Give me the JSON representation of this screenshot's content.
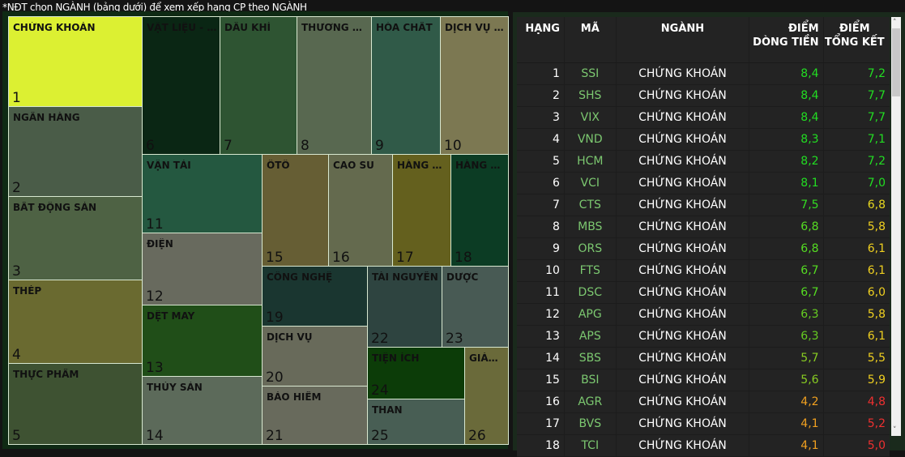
{
  "note": "*NĐT chọn NGÀNH (bảng dưới) để xem xếp hạng CP theo NGÀNH",
  "treemap": [
    {
      "label": "CHỨNG KHOÁN",
      "rank": "1",
      "color": "#dcf032"
    },
    {
      "label": "NGÂN HÀNG",
      "rank": "2",
      "color": "#4a5c48"
    },
    {
      "label": "BẤT ĐỘNG SẢN",
      "rank": "3",
      "color": "#4e6244"
    },
    {
      "label": "THÉP",
      "rank": "4",
      "color": "#6a6a30"
    },
    {
      "label": "THỰC PHẨM",
      "rank": "5",
      "color": "#3e5232"
    },
    {
      "label": "VẬT LIỆU - X...",
      "rank": "6",
      "color": "#0a2614"
    },
    {
      "label": "DẦU KHÍ",
      "rank": "7",
      "color": "#2e5432"
    },
    {
      "label": "THƯƠNG MẠI",
      "rank": "8",
      "color": "#586850"
    },
    {
      "label": "HÓA CHẤT",
      "rank": "9",
      "color": "#305a48"
    },
    {
      "label": "DỊCH VỤ T...",
      "rank": "10",
      "color": "#7c7852"
    },
    {
      "label": "VẬN TẢI",
      "rank": "11",
      "color": "#245840"
    },
    {
      "label": "ĐIỆN",
      "rank": "12",
      "color": "#686a5e"
    },
    {
      "label": "DỆT MAY",
      "rank": "13",
      "color": "#204e18"
    },
    {
      "label": "THỦY SẢN",
      "rank": "14",
      "color": "#5c6a5a"
    },
    {
      "label": "ÔTÔ",
      "rank": "15",
      "color": "#665e34"
    },
    {
      "label": "CAO SU",
      "rank": "16",
      "color": "#646a4e"
    },
    {
      "label": "HÀNG K...",
      "rank": "17",
      "color": "#64601e"
    },
    {
      "label": "HÀNG D...",
      "rank": "18",
      "color": "#0c3c24"
    },
    {
      "label": "CÔNG NGHỆ",
      "rank": "19",
      "color": "#1a3630"
    },
    {
      "label": "DỊCH VỤ",
      "rank": "20",
      "color": "#686a5a"
    },
    {
      "label": "BẢO HIỂM",
      "rank": "21",
      "color": "#686a5c"
    },
    {
      "label": "TÀI NGUYÊN",
      "rank": "22",
      "color": "#2e4440"
    },
    {
      "label": "DƯỢC",
      "rank": "23",
      "color": "#485a54"
    },
    {
      "label": "TIỆN ÍCH",
      "rank": "24",
      "color": "#0c3c08"
    },
    {
      "label": "THAN",
      "rank": "25",
      "color": "#485e54"
    },
    {
      "label": "GIÁO...",
      "rank": "26",
      "color": "#6a6a3a"
    }
  ],
  "table": {
    "headers": {
      "rank": "HẠNG",
      "code": "MÃ",
      "sector": "NGÀNH",
      "flow": "ĐIỂM DÒNG TIỀN",
      "total": "ĐIỂM TỔNG KẾT"
    },
    "rows": [
      {
        "rank": "1",
        "code": "SSI",
        "sector": "CHỨNG KHOÁN",
        "flow": "8,4",
        "total": "7,2",
        "flow_color": "#22dd22",
        "total_color": "#22dd22"
      },
      {
        "rank": "2",
        "code": "SHS",
        "sector": "CHỨNG KHOÁN",
        "flow": "8,4",
        "total": "7,7",
        "flow_color": "#22dd22",
        "total_color": "#22dd22"
      },
      {
        "rank": "3",
        "code": "VIX",
        "sector": "CHỨNG KHOÁN",
        "flow": "8,4",
        "total": "7,7",
        "flow_color": "#22dd22",
        "total_color": "#22dd22"
      },
      {
        "rank": "4",
        "code": "VND",
        "sector": "CHỨNG KHOÁN",
        "flow": "8,3",
        "total": "7,1",
        "flow_color": "#22dd22",
        "total_color": "#22dd22"
      },
      {
        "rank": "5",
        "code": "HCM",
        "sector": "CHỨNG KHOÁN",
        "flow": "8,2",
        "total": "7,2",
        "flow_color": "#22dd22",
        "total_color": "#22dd22"
      },
      {
        "rank": "6",
        "code": "VCI",
        "sector": "CHỨNG KHOÁN",
        "flow": "8,1",
        "total": "7,0",
        "flow_color": "#22dd22",
        "total_color": "#22dd22"
      },
      {
        "rank": "7",
        "code": "CTS",
        "sector": "CHỨNG KHOÁN",
        "flow": "7,5",
        "total": "6,8",
        "flow_color": "#33dd22",
        "total_color": "#e8d820"
      },
      {
        "rank": "8",
        "code": "MBS",
        "sector": "CHỨNG KHOÁN",
        "flow": "6,8",
        "total": "5,8",
        "flow_color": "#55dd22",
        "total_color": "#f0d020"
      },
      {
        "rank": "9",
        "code": "ORS",
        "sector": "CHỨNG KHOÁN",
        "flow": "6,8",
        "total": "6,1",
        "flow_color": "#55dd22",
        "total_color": "#f0d020"
      },
      {
        "rank": "10",
        "code": "FTS",
        "sector": "CHỨNG KHOÁN",
        "flow": "6,7",
        "total": "6,1",
        "flow_color": "#55dd22",
        "total_color": "#f0d020"
      },
      {
        "rank": "11",
        "code": "DSC",
        "sector": "CHỨNG KHOÁN",
        "flow": "6,7",
        "total": "6,0",
        "flow_color": "#55dd22",
        "total_color": "#f0d020"
      },
      {
        "rank": "12",
        "code": "APG",
        "sector": "CHỨNG KHOÁN",
        "flow": "6,3",
        "total": "5,8",
        "flow_color": "#66cc22",
        "total_color": "#f0d020"
      },
      {
        "rank": "13",
        "code": "APS",
        "sector": "CHỨNG KHOÁN",
        "flow": "6,3",
        "total": "6,1",
        "flow_color": "#66cc22",
        "total_color": "#f0d020"
      },
      {
        "rank": "14",
        "code": "SBS",
        "sector": "CHỨNG KHOÁN",
        "flow": "5,7",
        "total": "5,5",
        "flow_color": "#88cc22",
        "total_color": "#f0d020"
      },
      {
        "rank": "15",
        "code": "BSI",
        "sector": "CHỨNG KHOÁN",
        "flow": "5,6",
        "total": "5,9",
        "flow_color": "#88cc22",
        "total_color": "#f0d020"
      },
      {
        "rank": "16",
        "code": "AGR",
        "sector": "CHỨNG KHOÁN",
        "flow": "4,2",
        "total": "4,8",
        "flow_color": "#f0a020",
        "total_color": "#ee3030"
      },
      {
        "rank": "17",
        "code": "BVS",
        "sector": "CHỨNG KHOÁN",
        "flow": "4,1",
        "total": "5,2",
        "flow_color": "#f0a020",
        "total_color": "#ee3030"
      },
      {
        "rank": "18",
        "code": "TCI",
        "sector": "CHỨNG KHOÁN",
        "flow": "4,1",
        "total": "5,0",
        "flow_color": "#f0a020",
        "total_color": "#ee3030"
      }
    ]
  }
}
